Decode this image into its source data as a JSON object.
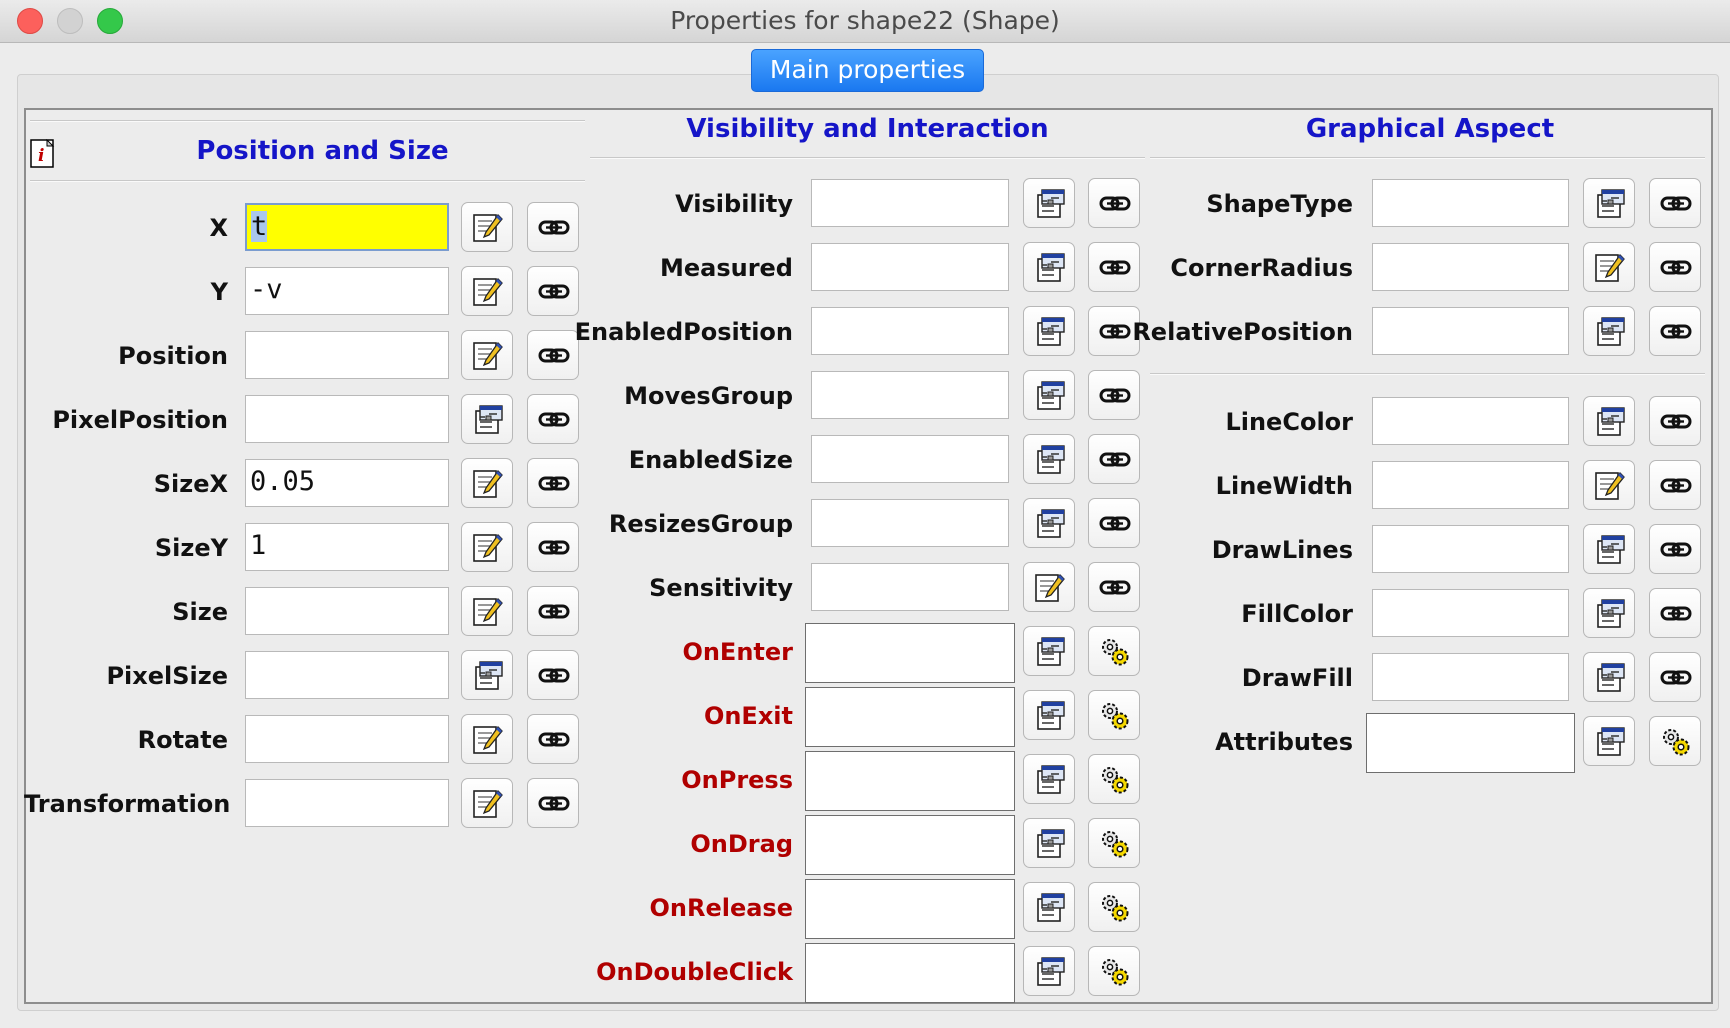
{
  "window": {
    "title": "Properties for shape22 (Shape)"
  },
  "tab": {
    "label": "Main properties"
  },
  "sections": {
    "position": "Position and Size",
    "visibility": "Visibility and Interaction",
    "graphical": "Graphical Aspect"
  },
  "position_rows": [
    {
      "label": "X",
      "value": "t",
      "edit_icon": "edit-pencil-icon",
      "focused": true
    },
    {
      "label": "Y",
      "value": "-v",
      "edit_icon": "edit-pencil-icon"
    },
    {
      "label": "Position",
      "value": "",
      "edit_icon": "edit-pencil-icon"
    },
    {
      "label": "PixelPosition",
      "value": "",
      "edit_icon": "properties-icon"
    },
    {
      "label": "SizeX",
      "value": "0.05",
      "edit_icon": "edit-pencil-icon"
    },
    {
      "label": "SizeY",
      "value": "1",
      "edit_icon": "edit-pencil-icon"
    },
    {
      "label": "Size",
      "value": "",
      "edit_icon": "edit-pencil-icon"
    },
    {
      "label": "PixelSize",
      "value": "",
      "edit_icon": "properties-icon"
    },
    {
      "label": "Rotate",
      "value": "",
      "edit_icon": "edit-pencil-icon"
    },
    {
      "label": "Transformation",
      "value": "",
      "edit_icon": "edit-pencil-icon"
    }
  ],
  "visibility_rows": [
    {
      "label": "Visibility",
      "value": "",
      "edit_icon": "properties-icon",
      "link_icon": "link-icon"
    },
    {
      "label": "Measured",
      "value": "",
      "edit_icon": "properties-icon",
      "link_icon": "link-icon"
    },
    {
      "label": "EnabledPosition",
      "value": "",
      "edit_icon": "properties-icon",
      "link_icon": "link-icon"
    },
    {
      "label": "MovesGroup",
      "value": "",
      "edit_icon": "properties-icon",
      "link_icon": "link-icon"
    },
    {
      "label": "EnabledSize",
      "value": "",
      "edit_icon": "properties-icon",
      "link_icon": "link-icon"
    },
    {
      "label": "ResizesGroup",
      "value": "",
      "edit_icon": "properties-icon",
      "link_icon": "link-icon"
    },
    {
      "label": "Sensitivity",
      "value": "",
      "edit_icon": "edit-pencil-icon",
      "link_icon": "link-icon"
    },
    {
      "label": "OnEnter",
      "value": "",
      "edit_icon": "properties-icon",
      "link_icon": "gears-icon",
      "action": true
    },
    {
      "label": "OnExit",
      "value": "",
      "edit_icon": "properties-icon",
      "link_icon": "gears-icon",
      "action": true
    },
    {
      "label": "OnPress",
      "value": "",
      "edit_icon": "properties-icon",
      "link_icon": "gears-icon",
      "action": true
    },
    {
      "label": "OnDrag",
      "value": "",
      "edit_icon": "properties-icon",
      "link_icon": "gears-icon",
      "action": true
    },
    {
      "label": "OnRelease",
      "value": "",
      "edit_icon": "properties-icon",
      "link_icon": "gears-icon",
      "action": true
    },
    {
      "label": "OnDoubleClick",
      "value": "",
      "edit_icon": "properties-icon",
      "link_icon": "gears-icon",
      "action": true
    }
  ],
  "graphical_rows": [
    {
      "label": "ShapeType",
      "value": "",
      "edit_icon": "properties-icon",
      "link_icon": "link-icon"
    },
    {
      "label": "CornerRadius",
      "value": "",
      "edit_icon": "edit-pencil-icon",
      "link_icon": "link-icon"
    },
    {
      "label": "RelativePosition",
      "value": "",
      "edit_icon": "properties-icon",
      "link_icon": "link-icon"
    },
    {
      "label": "LineColor",
      "value": "",
      "edit_icon": "properties-icon",
      "link_icon": "link-icon"
    },
    {
      "label": "LineWidth",
      "value": "",
      "edit_icon": "edit-pencil-icon",
      "link_icon": "link-icon"
    },
    {
      "label": "DrawLines",
      "value": "",
      "edit_icon": "properties-icon",
      "link_icon": "link-icon"
    },
    {
      "label": "FillColor",
      "value": "",
      "edit_icon": "properties-icon",
      "link_icon": "link-icon"
    },
    {
      "label": "DrawFill",
      "value": "",
      "edit_icon": "properties-icon",
      "link_icon": "link-icon"
    },
    {
      "label": "Attributes",
      "value": "",
      "edit_icon": "properties-icon",
      "link_icon": "gears-icon",
      "big": true
    }
  ],
  "colors": {
    "header_blue": "#1515c8",
    "action_red": "#b00000",
    "focused_field": "#ffff00",
    "tab_blue": "#1a78f0"
  }
}
